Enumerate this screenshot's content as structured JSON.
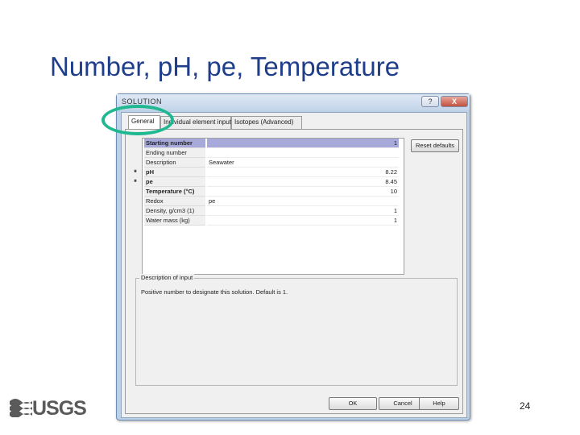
{
  "slide": {
    "title": "Number, pH, pe, Temperature",
    "page_number": "24",
    "logo_text": "USGS"
  },
  "dialog": {
    "title": "SOLUTION",
    "help_label": "?",
    "close_label": "X",
    "tabs": [
      {
        "label": "General",
        "active": true
      },
      {
        "label": "Individual element input",
        "active": false
      },
      {
        "label": "Isotopes (Advanced)",
        "active": false
      }
    ],
    "reset_label": "Reset defaults",
    "grid_rows": [
      {
        "marker": "",
        "name": "Starting number",
        "value": "",
        "number": "1",
        "selected": true,
        "bold": true
      },
      {
        "marker": "",
        "name": "Ending number",
        "value": "",
        "number": "",
        "selected": false,
        "bold": false
      },
      {
        "marker": "",
        "name": "Description",
        "value": "Seawater",
        "number": "",
        "selected": false,
        "bold": false
      },
      {
        "marker": "*",
        "name": "pH",
        "value": "",
        "number": "8.22",
        "selected": false,
        "bold": true
      },
      {
        "marker": "*",
        "name": "pe",
        "value": "",
        "number": "8.45",
        "selected": false,
        "bold": true
      },
      {
        "marker": "",
        "name": "Temperature (°C)",
        "value": "",
        "number": "10",
        "selected": false,
        "bold": true
      },
      {
        "marker": "",
        "name": "Redox",
        "value": "pe",
        "number": "",
        "selected": false,
        "bold": false
      },
      {
        "marker": "",
        "name": "Density, g/cm3 (1)",
        "value": "",
        "number": "1",
        "selected": false,
        "bold": false
      },
      {
        "marker": "",
        "name": "Water mass (kg)",
        "value": "",
        "number": "1",
        "selected": false,
        "bold": false
      }
    ],
    "description_legend": "Description of input",
    "description_text": "Positive number to designate this solution. Default is 1.",
    "ok_label": "OK",
    "cancel_label": "Cancel",
    "help_button_label": "Help"
  },
  "colors": {
    "title": "#1f3e8a",
    "highlight": "#1fb890",
    "selected_row": "#a7a9da"
  }
}
